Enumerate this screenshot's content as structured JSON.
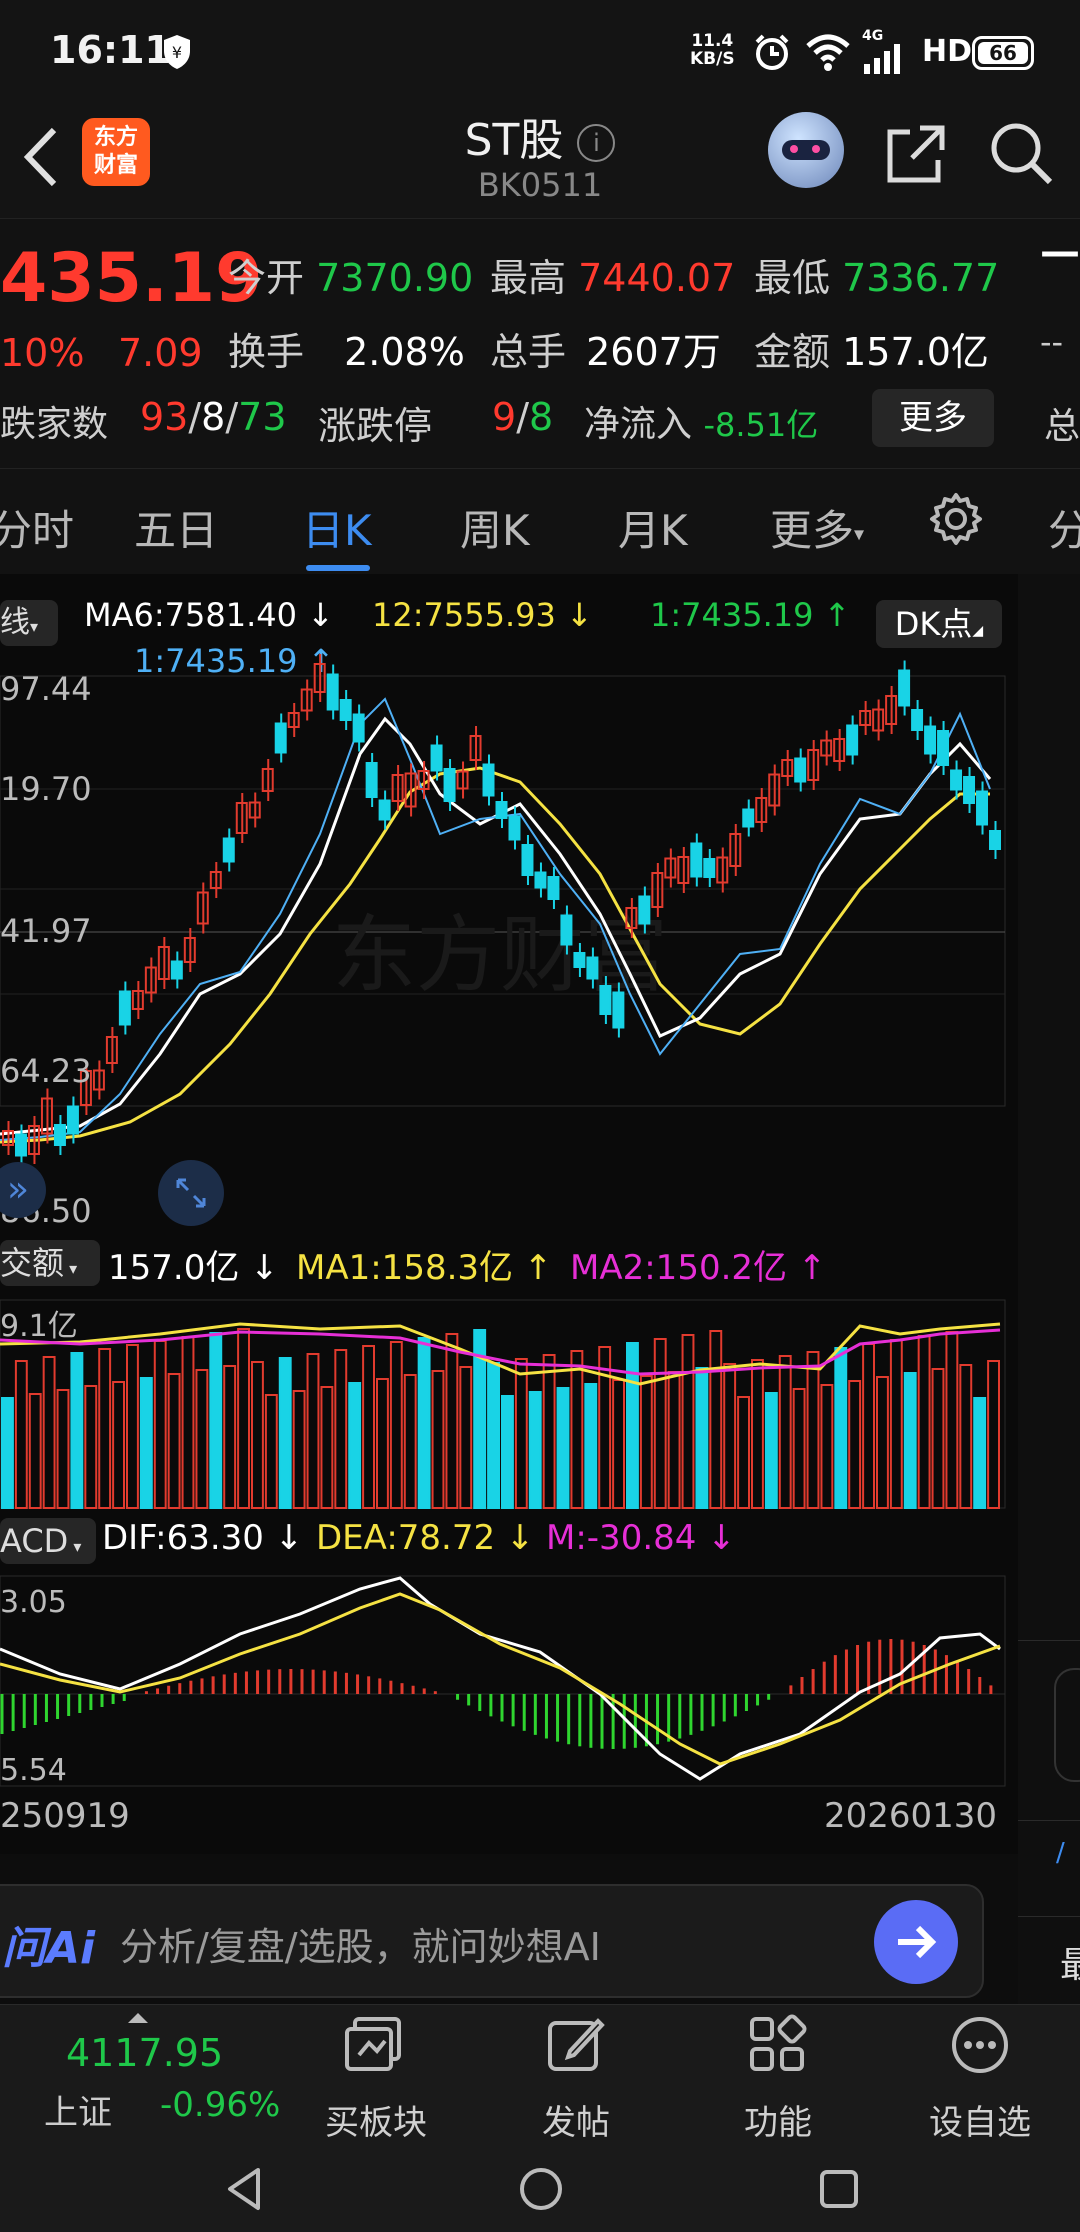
{
  "status_bar": {
    "time": "16:11",
    "net_speed_top": "11.4",
    "net_speed_bottom": "KB/S",
    "signal_label": "4G",
    "hd_label": "HD",
    "battery": "66"
  },
  "header": {
    "title": "ST股",
    "code": "BK0511",
    "logo_text_line1": "东方",
    "logo_text_line2": "财富"
  },
  "quote": {
    "price": "435.19",
    "change_pct": "10%",
    "change_abs": "7.09",
    "open_label": "今开",
    "open_value": "7370.90",
    "high_label": "最高",
    "high_value": "7440.07",
    "low_label": "最低",
    "low_value": "7336.77",
    "turnover_label": "换手",
    "turnover_value": "2.08%",
    "vol_label": "总手",
    "vol_value": "2607万",
    "amount_label": "金额",
    "amount_value": "157.0亿",
    "breadth_label": "跌家数",
    "breadth_up": "93",
    "breadth_flat": "8",
    "breadth_down": "73",
    "sep": "/",
    "limit_label": "涨跌停",
    "limit_up": "9",
    "limit_down": "8",
    "netflow_label": "净流入",
    "netflow_value": "-8.51亿",
    "more_button": "更多",
    "right_dash1": "—",
    "right_dash2": "--",
    "right_cut": "总"
  },
  "tabs": [
    {
      "label": "分时"
    },
    {
      "label": "五日"
    },
    {
      "label": "日K"
    },
    {
      "label": "周K"
    },
    {
      "label": "月K"
    },
    {
      "label": "更多"
    },
    {
      "label": "分"
    }
  ],
  "kline": {
    "type_label": "线",
    "ma6": "MA6:7581.40",
    "ma12": "12:7555.93",
    "ma_up1": "1:7435.19",
    "ma_up2": "1:7435.19",
    "dk_button": "DK点",
    "y_ticks": [
      "97.44",
      "19.70",
      "41.97",
      "64.23",
      "86.50"
    ],
    "watermark": "东方财富",
    "colors": {
      "up": "#e23b2e",
      "down": "#19d3e6",
      "ma_white": "#ffffff",
      "ma_yellow": "#f5e243",
      "ma_blue": "#4fb0f5"
    }
  },
  "volume": {
    "label": "交额",
    "value": "157.0亿",
    "ma1": "MA1:158.3亿",
    "ma2": "MA2:150.2亿",
    "axis_cut": "9.1亿"
  },
  "macd": {
    "label": "ACD",
    "dif": "DIF:63.30",
    "dea": "DEA:78.72",
    "m": "M:-30.84",
    "y_top": "3.05",
    "y_bottom": "5.54"
  },
  "x_axis": {
    "start": "250919",
    "end": "20260130"
  },
  "ai_bar": {
    "brand": "问Ai",
    "placeholder": "分析/复盘/选股，就问妙想AI"
  },
  "bottom_nav": {
    "index_value": "4117.95",
    "index_name": "上证",
    "index_change": "-0.96%",
    "items": [
      {
        "label": "买板块",
        "icon": "sector-icon"
      },
      {
        "label": "发帖",
        "icon": "edit-icon"
      },
      {
        "label": "功能",
        "icon": "grid-icon"
      },
      {
        "label": "设自选",
        "icon": "more-icon"
      }
    ]
  },
  "right_panel": {
    "char1": "最"
  }
}
